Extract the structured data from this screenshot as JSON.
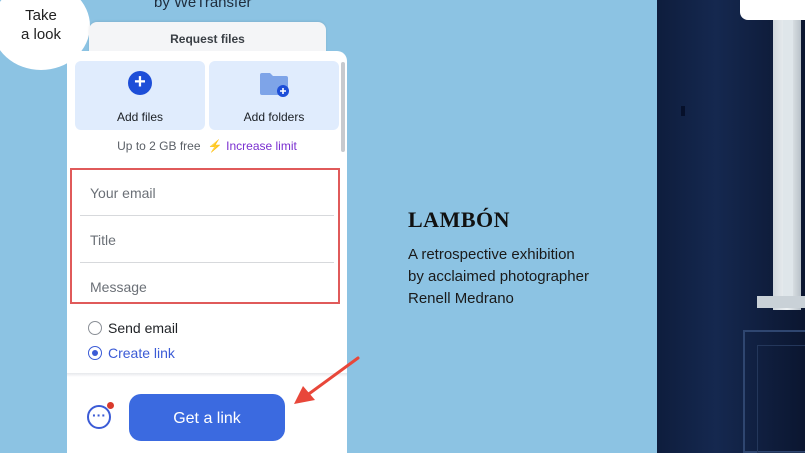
{
  "bubble": {
    "line1": "Take",
    "line2": "a look"
  },
  "header": {
    "byline": "by WeTransfer"
  },
  "panel": {
    "tab_title": "Request files",
    "add_files": "Add files",
    "add_folders": "Add folders",
    "limit_text": "Up to 2 GB free",
    "increase_limit": "Increase limit",
    "fields": {
      "email_placeholder": "Your email",
      "title_placeholder": "Title",
      "message_placeholder": "Message"
    },
    "options": {
      "send_email": "Send email",
      "create_link": "Create link",
      "selected": "create_link"
    },
    "more_icon": "ellipsis-icon",
    "primary_button": "Get a link"
  },
  "exhibition": {
    "title": "LAMBÓN",
    "line1": "A retrospective exhibition",
    "line2": "by acclaimed photographer",
    "line3": "Renell Medrano"
  },
  "colors": {
    "background": "#8cc3e3",
    "accent": "#3b6ae0",
    "highlight_border": "#e05a5a",
    "annotation_arrow": "#e8473a"
  }
}
